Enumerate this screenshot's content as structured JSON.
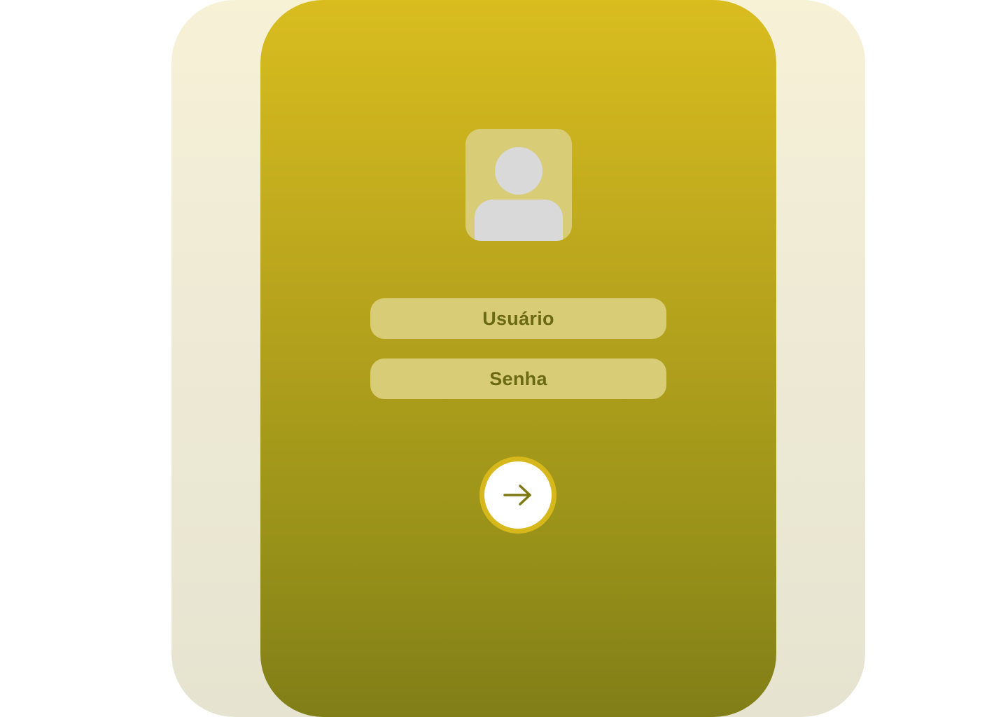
{
  "login": {
    "username_placeholder": "Usuário",
    "password_placeholder": "Senha"
  },
  "icons": {
    "avatar": "user-avatar-icon",
    "submit": "arrow-right-icon"
  },
  "colors": {
    "accent": "#d7b81c",
    "field_bg": "#d9cc77",
    "field_text": "#6b6a12",
    "card_top": "#d9bd1f",
    "card_bottom": "#817e18"
  }
}
